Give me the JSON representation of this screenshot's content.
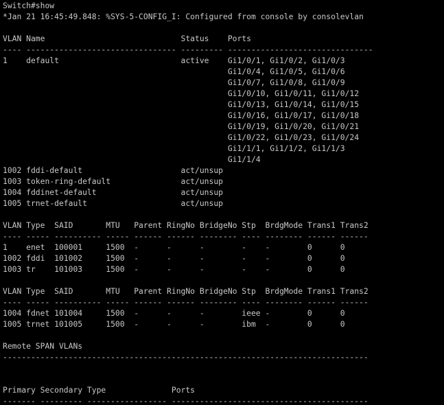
{
  "terminal": {
    "colors": {
      "background": "#000000",
      "foreground": "#c9c9c9"
    },
    "lines": [
      "Switch#show",
      "*Jan 21 16:45:49.848: %SYS-5-CONFIG_I: Configured from console by consolevlan",
      "",
      "VLAN Name                             Status    Ports",
      "---- -------------------------------- --------- -------------------------------",
      "1    default                          active    Gi1/0/1, Gi1/0/2, Gi1/0/3",
      "                                                Gi1/0/4, Gi1/0/5, Gi1/0/6",
      "                                                Gi1/0/7, Gi1/0/8, Gi1/0/9",
      "                                                Gi1/0/10, Gi1/0/11, Gi1/0/12",
      "                                                Gi1/0/13, Gi1/0/14, Gi1/0/15",
      "                                                Gi1/0/16, Gi1/0/17, Gi1/0/18",
      "                                                Gi1/0/19, Gi1/0/20, Gi1/0/21",
      "                                                Gi1/0/22, Gi1/0/23, Gi1/0/24",
      "                                                Gi1/1/1, Gi1/1/2, Gi1/1/3",
      "                                                Gi1/1/4",
      "1002 fddi-default                     act/unsup",
      "1003 token-ring-default               act/unsup",
      "1004 fddinet-default                  act/unsup",
      "1005 trnet-default                    act/unsup",
      "",
      "VLAN Type  SAID       MTU   Parent RingNo BridgeNo Stp  BrdgMode Trans1 Trans2",
      "---- ----- ---------- ----- ------ ------ -------- ---- -------- ------ ------",
      "1    enet  100001     1500  -      -      -        -    -        0      0",
      "1002 fddi  101002     1500  -      -      -        -    -        0      0",
      "1003 tr    101003     1500  -      -      -        -    -        0      0",
      "",
      "VLAN Type  SAID       MTU   Parent RingNo BridgeNo Stp  BrdgMode Trans1 Trans2",
      "---- ----- ---------- ----- ------ ------ -------- ---- -------- ------ ------",
      "1004 fdnet 101004     1500  -      -      -        ieee -        0      0",
      "1005 trnet 101005     1500  -      -      -        ibm  -        0      0",
      "",
      "Remote SPAN VLANs",
      "------------------------------------------------------------------------------",
      "",
      "",
      "Primary Secondary Type              Ports",
      "------- --------- ----------------- ------------------------------------------"
    ]
  }
}
